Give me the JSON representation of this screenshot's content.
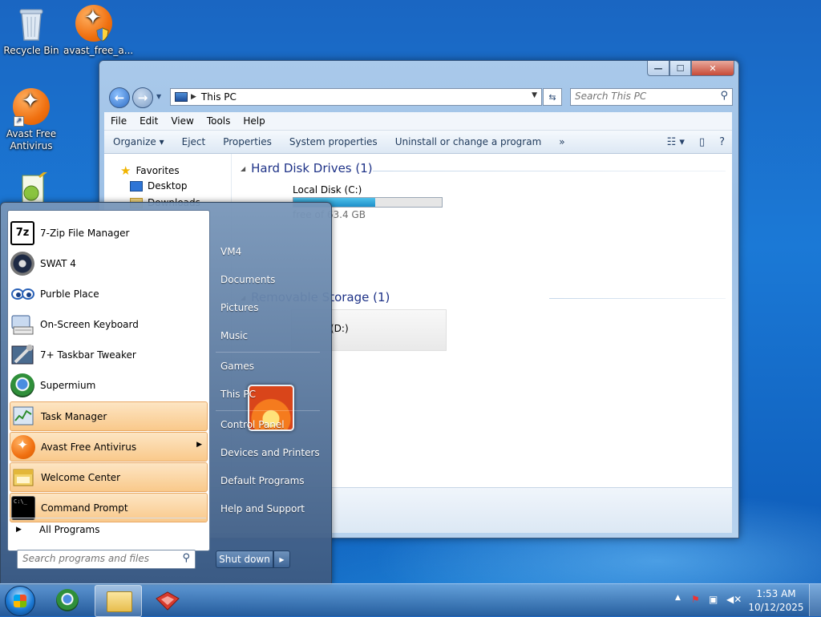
{
  "desktop": {
    "icons": [
      {
        "label": "Recycle Bin"
      },
      {
        "label": "avast_free_a..."
      },
      {
        "label": "Avast Free Antivirus"
      }
    ]
  },
  "explorer": {
    "address": "This PC",
    "search_placeholder": "Search This PC",
    "window_controls": {
      "minimize": "—",
      "maximize": "☐",
      "close": "✕"
    },
    "menu": [
      "File",
      "Edit",
      "View",
      "Tools",
      "Help"
    ],
    "commands": [
      "Organize ▾",
      "Eject",
      "Properties",
      "System properties",
      "Uninstall or change a program",
      "»"
    ],
    "nav": {
      "favorites": "Favorites",
      "desktop": "Desktop",
      "downloads": "Downloads"
    },
    "groups": {
      "hard_disk": "Hard Disk Drives (1)",
      "removable": "Removable Storage (1)"
    },
    "drives": {
      "c_label": "Local Disk (C:)",
      "c_free": "free of 63.4 GB",
      "c_used_fraction": 0.55,
      "d_label": "(D:)"
    }
  },
  "start_menu": {
    "programs": [
      {
        "label": "7-Zip File Manager",
        "icon": "7zip-icon"
      },
      {
        "label": "SWAT 4",
        "icon": "swat-icon"
      },
      {
        "label": "Purble Place",
        "icon": "purble-icon"
      },
      {
        "label": "On-Screen Keyboard",
        "icon": "keyboard-icon"
      },
      {
        "label": "7+ Taskbar Tweaker",
        "icon": "tweaker-icon"
      },
      {
        "label": "Supermium",
        "icon": "supermium-icon"
      },
      {
        "label": "Task Manager",
        "icon": "task-manager-icon"
      },
      {
        "label": "Avast Free Antivirus",
        "icon": "avast-icon"
      },
      {
        "label": "Welcome Center",
        "icon": "welcome-icon"
      },
      {
        "label": "Command Prompt",
        "icon": "cmd-icon"
      }
    ],
    "all_programs": "All Programs",
    "search_placeholder": "Search programs and files",
    "right_links": [
      "VM4",
      "Documents",
      "Pictures",
      "Music",
      "Games",
      "This PC",
      "Control Panel",
      "Devices and Printers",
      "Default Programs",
      "Help and Support"
    ],
    "shutdown": "Shut down"
  },
  "taskbar": {
    "time": "1:53 AM",
    "date": "10/12/2025"
  },
  "colors": {
    "accent": "#1e3287",
    "highlight": "#f9c98b",
    "desktop": "#1b79d6"
  }
}
